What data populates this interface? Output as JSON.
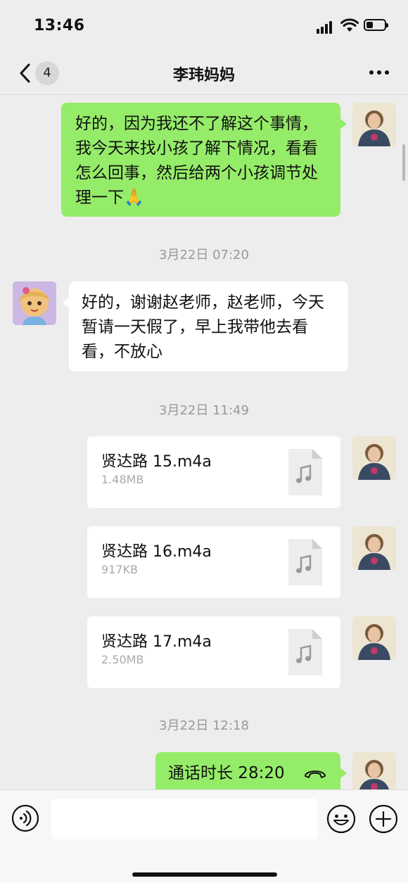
{
  "status_bar": {
    "time": "13:46"
  },
  "nav": {
    "back_badge": "4",
    "title": "李玮妈妈"
  },
  "messages": {
    "m1": {
      "text": "好的，因为我还不了解这个事情，我今天来找小孩了解下情况，看看怎么回事，然后给两个小孩调节处理一下",
      "emoji": "🙏"
    },
    "ts1": "3月22日 07:20",
    "m2": {
      "text": "好的，谢谢赵老师，赵老师，今天暂请一天假了，早上我带他去看看，不放心"
    },
    "ts2": "3月22日 11:49",
    "files": [
      {
        "name": "贤达路 15.m4a",
        "size": "1.48MB"
      },
      {
        "name": "贤达路 16.m4a",
        "size": "917KB"
      },
      {
        "name": "贤达路 17.m4a",
        "size": "2.50MB"
      }
    ],
    "ts3": "3月22日 12:18",
    "call": {
      "label": "通话时长 28:20"
    }
  },
  "input": {
    "placeholder": ""
  },
  "icons": {
    "back": "chevron-left-icon",
    "more": "more-dots-icon",
    "voice": "voice-input-icon",
    "emoji": "emoji-icon",
    "plus": "plus-icon",
    "file": "audio-file-icon",
    "call": "phone-hangup-icon"
  },
  "colors": {
    "background": "#ededed",
    "self_bubble": "#95ec69",
    "other_bubble": "#ffffff",
    "timestamp": "#999999"
  }
}
